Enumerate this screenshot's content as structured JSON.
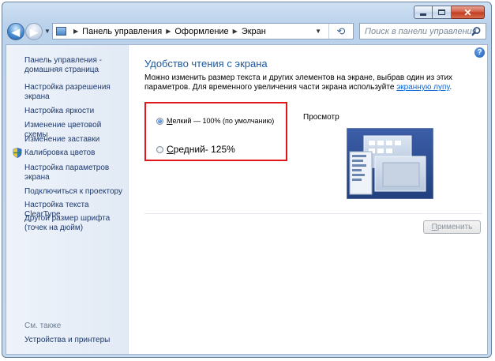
{
  "window": {
    "controls": {
      "minimize": "minimize",
      "maximize": "maximize",
      "close": "close"
    }
  },
  "navbar": {
    "breadcrumb": [
      "Панель управления",
      "Оформление",
      "Экран"
    ],
    "search_placeholder": "Поиск в панели управления"
  },
  "sidebar": {
    "items": [
      {
        "label": "Панель управления - домашняя страница",
        "icon": ""
      },
      {
        "label": "Настройка разрешения экрана",
        "icon": ""
      },
      {
        "label": "Настройка яркости",
        "icon": ""
      },
      {
        "label": "Изменение цветовой схемы",
        "icon": ""
      },
      {
        "label": "Изменение заставки",
        "icon": ""
      },
      {
        "label": "Калибровка цветов",
        "icon": "shield-icon"
      },
      {
        "label": "Настройка параметров экрана",
        "icon": ""
      },
      {
        "label": "Подключиться к проектору",
        "icon": ""
      },
      {
        "label": "Настройка текста ClearType",
        "icon": ""
      },
      {
        "label": "Другой размер шрифта (точек на дюйм)",
        "icon": ""
      }
    ],
    "see_also_label": "См. также",
    "see_also_items": [
      {
        "label": "Устройства и принтеры"
      }
    ]
  },
  "main": {
    "title": "Удобство чтения с экрана",
    "description": "Можно изменить размер текста и других элементов на экране, выбрав один из этих параметров. Для временного увеличения части экрана используйте",
    "description_link": "экранную лупу",
    "description_end": ".",
    "options": [
      {
        "label_hotkey": "М",
        "label_rest": "елкий — 100% (по умолчанию)",
        "checked": true
      },
      {
        "label_hotkey": "С",
        "label_rest": "редний- 125%",
        "checked": false
      }
    ],
    "preview_label": "Просмотр",
    "apply_hotkey": "П",
    "apply_rest": "рименить",
    "apply_enabled": false
  },
  "colors": {
    "link": "#1e3a6e",
    "title": "#1e5a9c",
    "highlight_border": "#e0161b"
  }
}
